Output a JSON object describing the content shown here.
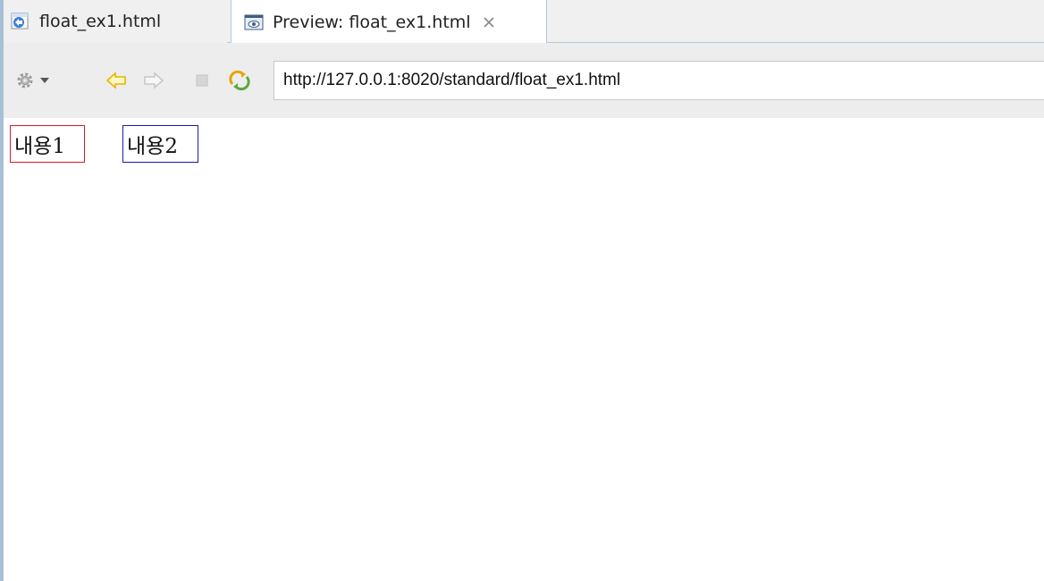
{
  "tabs": [
    {
      "label": "float_ex1.html",
      "icon": "html-file-icon",
      "active": false
    },
    {
      "label": "Preview: float_ex1.html",
      "icon": "preview-icon",
      "active": true
    }
  ],
  "toolbar": {
    "icons": [
      "gear-icon",
      "chevron-down-icon",
      "back-arrow-icon",
      "forward-arrow-icon",
      "stop-icon",
      "refresh-icon"
    ],
    "url": "http://127.0.0.1:8020/standard/float_ex1.html"
  },
  "content": {
    "box1": "내용1",
    "box2": "내용2"
  },
  "colors": {
    "box1_border": "#e0181f",
    "box2_border": "#1a1aa8",
    "arrow": "#e8b400"
  }
}
